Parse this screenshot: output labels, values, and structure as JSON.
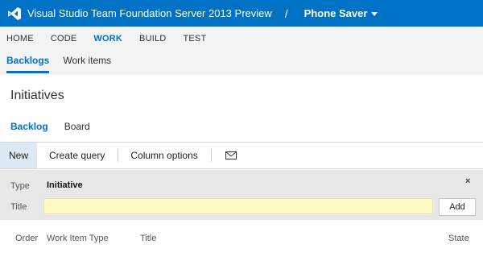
{
  "header": {
    "product": "Visual Studio Team Foundation Server 2013 Preview",
    "separator": "/",
    "project": "Phone Saver"
  },
  "hubs": [
    "HOME",
    "CODE",
    "WORK",
    "BUILD",
    "TEST"
  ],
  "hubs_active": "WORK",
  "subnav": [
    "Backlogs",
    "Work items"
  ],
  "page_title": "Initiatives",
  "tabs": [
    "Backlog",
    "Board"
  ],
  "toolbar": {
    "new_label": "New",
    "create_query_label": "Create query",
    "column_options_label": "Column options",
    "mail_icon": "mail-icon"
  },
  "form": {
    "type_label": "Type",
    "type_value": "Initiative",
    "title_label": "Title",
    "title_value": "",
    "add_label": "Add",
    "close_glyph": "×"
  },
  "grid": {
    "columns": [
      "Order",
      "Work Item Type",
      "Title",
      "State"
    ]
  },
  "colors": {
    "accent": "#0072c6",
    "input_bg": "#fffbc6",
    "form_bg": "#e8e8e8"
  }
}
